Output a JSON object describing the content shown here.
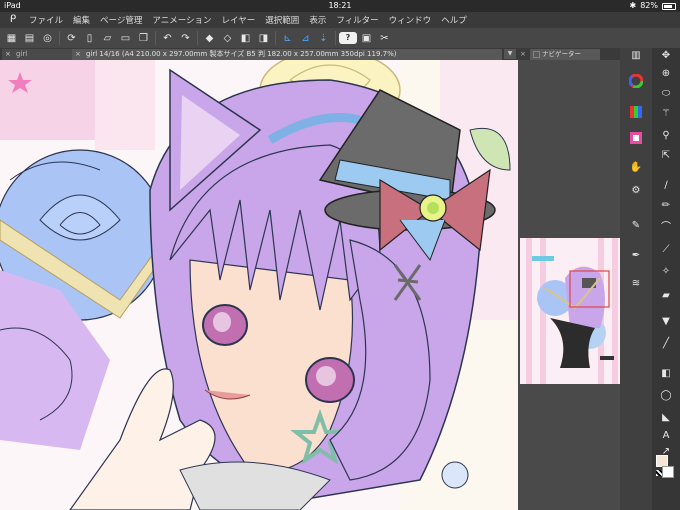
{
  "status_bar": {
    "device": "iPad",
    "time": "18:21",
    "battery": "82%",
    "battery_level": 0.82
  },
  "menu": {
    "logo_icon": "clip-studio-logo-icon",
    "items": [
      "ファイル",
      "編集",
      "ページ管理",
      "アニメーション",
      "レイヤー",
      "選択範囲",
      "表示",
      "フィルター",
      "ウィンドウ",
      "ヘルプ"
    ]
  },
  "command_bar": {
    "icons": [
      "grid-icon",
      "stack-icon",
      "spinner-icon",
      "reload-icon",
      "new-icon",
      "open-icon",
      "save-icon",
      "copy-icon",
      "undo-icon",
      "redo-icon",
      "eraser-icon",
      "clear-icon",
      "rotate-left-icon",
      "rotate-right-icon",
      "snap-1-icon",
      "snap-2-icon",
      "snap-3-icon"
    ],
    "help_label": "?"
  },
  "tabs": [
    {
      "label": "girl",
      "active": false
    },
    {
      "label": "girl 14/16 (A4 210.00 x 297.00mm 製本サイズ B5 判 182.00 x 257.00mm 350dpi 119.7%)",
      "active": true
    }
  ],
  "navigator": {
    "tab_label": "ナビゲーター"
  },
  "tools": {
    "column1": [
      "layer-icon",
      "color-wheel-icon",
      "rgb-icon",
      "layer-properties-icon",
      "history-icon",
      "hand-icon",
      "gear-icon",
      "brush-icon",
      "pen-icon",
      "layers-icon"
    ],
    "column2": [
      "move-icon",
      "zoom-icon",
      "lasso-icon",
      "magic-wand-icon",
      "eyedropper-icon",
      "pen-tool-icon",
      "pencil-icon",
      "brush-tool-icon",
      "airbrush-icon",
      "decoration-icon",
      "eraser-tool-icon",
      "fill-icon",
      "gradient-icon",
      "figure-icon",
      "frame-icon",
      "balloon-icon",
      "text-icon",
      "ruler-icon",
      "correct-icon"
    ],
    "text_tool_label": "A"
  },
  "colors": {
    "accent": "#4aa3ff",
    "hair": "#c9a6ea",
    "hat": "#6b6b6b",
    "bow": "#c8707e",
    "ribbon": "#9ccaf0",
    "rose": "#a9c4f5"
  }
}
